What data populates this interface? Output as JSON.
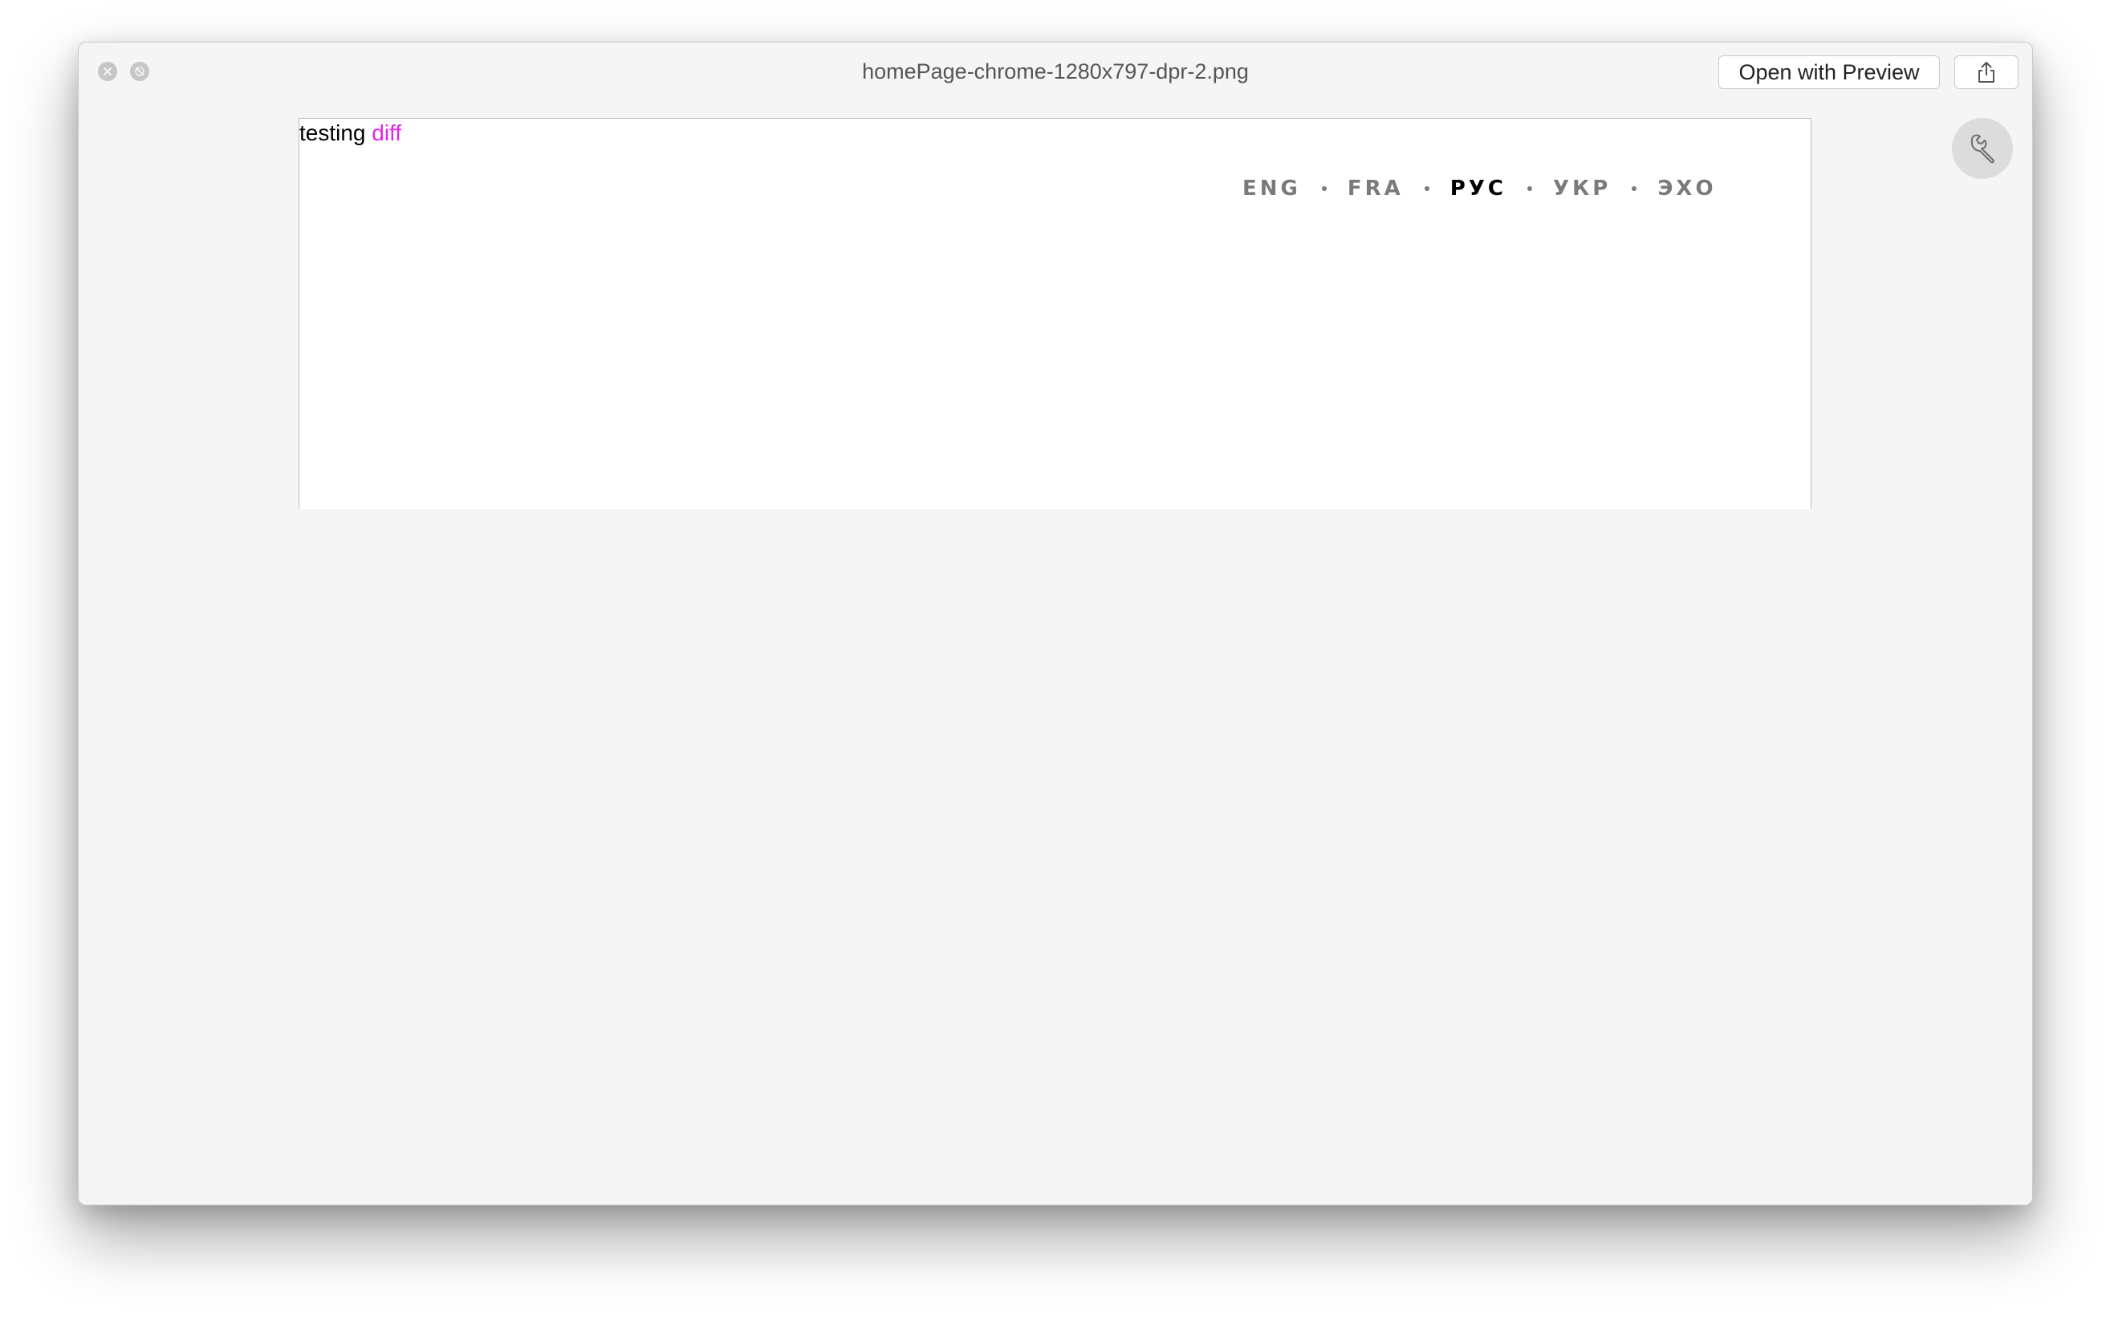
{
  "window": {
    "title": "homePage-chrome-1280x797-dpr-2.png",
    "open_button_label": "Open with Preview"
  },
  "preview": {
    "text_plain": "testing",
    "text_highlight": "diff",
    "highlight_color": "#e226e8",
    "languages": [
      {
        "label": "ENG",
        "active": false
      },
      {
        "label": "FRA",
        "active": false
      },
      {
        "label": "РУС",
        "active": true
      },
      {
        "label": "УКР",
        "active": false
      },
      {
        "label": "ЭХО",
        "active": false
      }
    ]
  },
  "icons": {
    "close": "close-icon",
    "minimize": "fullscreen-off-icon",
    "share": "share-icon",
    "tool": "wrench-icon"
  }
}
